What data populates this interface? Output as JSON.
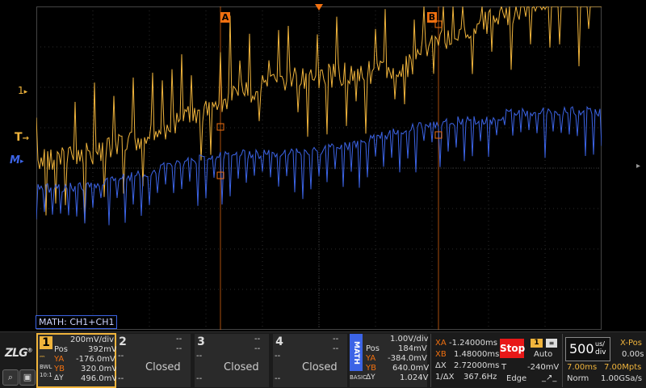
{
  "markers": {
    "cursor_a": "A",
    "cursor_b": "B",
    "ch1_level": "1",
    "trigger_level": "T",
    "math_level": "M"
  },
  "math_label": "MATH: CH1+CH1",
  "channels": {
    "ch1": {
      "num": "1",
      "scale": "200mV/div",
      "pos_label": "Pos",
      "pos": "392mV",
      "ya_label": "YA",
      "ya": "-176.0mV",
      "yb_label": "YB",
      "yb": "320.0mV",
      "dy_label": "ΔY",
      "dy": "496.0mV",
      "coupling": "DC",
      "bw": "BWL",
      "probe": "10:1"
    },
    "ch2": {
      "num": "2",
      "status": "Closed",
      "dash": "--"
    },
    "ch3": {
      "num": "3",
      "status": "Closed",
      "dash": "--"
    },
    "ch4": {
      "num": "4",
      "status": "Closed",
      "dash": "--"
    },
    "math": {
      "tag": "MATH",
      "sub": "BASIC",
      "scale": "1.00V/div",
      "pos_label": "Pos",
      "pos": "184mV",
      "ya_label": "YA",
      "ya": "-384.0mV",
      "yb_label": "YB",
      "yb": "640.0mV",
      "dy_label": "ΔY",
      "dy": "1.024V"
    }
  },
  "cursors": {
    "xa_label": "XA",
    "xa": "-1.24000ms",
    "xb_label": "XB",
    "xb": "1.48000ms",
    "dx_label": "ΔX",
    "dx": "2.72000ms",
    "inv_label": "1/ΔX",
    "inv": "367.6Hz"
  },
  "trigger": {
    "run_state": "Stop",
    "source": "1",
    "mode": "Auto",
    "t_label": "T",
    "level": "-240mV",
    "type": "Edge"
  },
  "timebase": {
    "value": "500",
    "unit_top": "us/",
    "unit_bottom": "div",
    "xpos_label": "X-Pos",
    "xpos": "0.00s",
    "mem_used": "7.00ms",
    "mem_pts": "7.00Mpts",
    "acq_mode": "Norm",
    "rate": "1.00GSa/s"
  },
  "colors": {
    "ch1": "#f0b43c",
    "math": "#3c64e6",
    "cursor": "#f07010",
    "stop": "#e81818"
  }
}
